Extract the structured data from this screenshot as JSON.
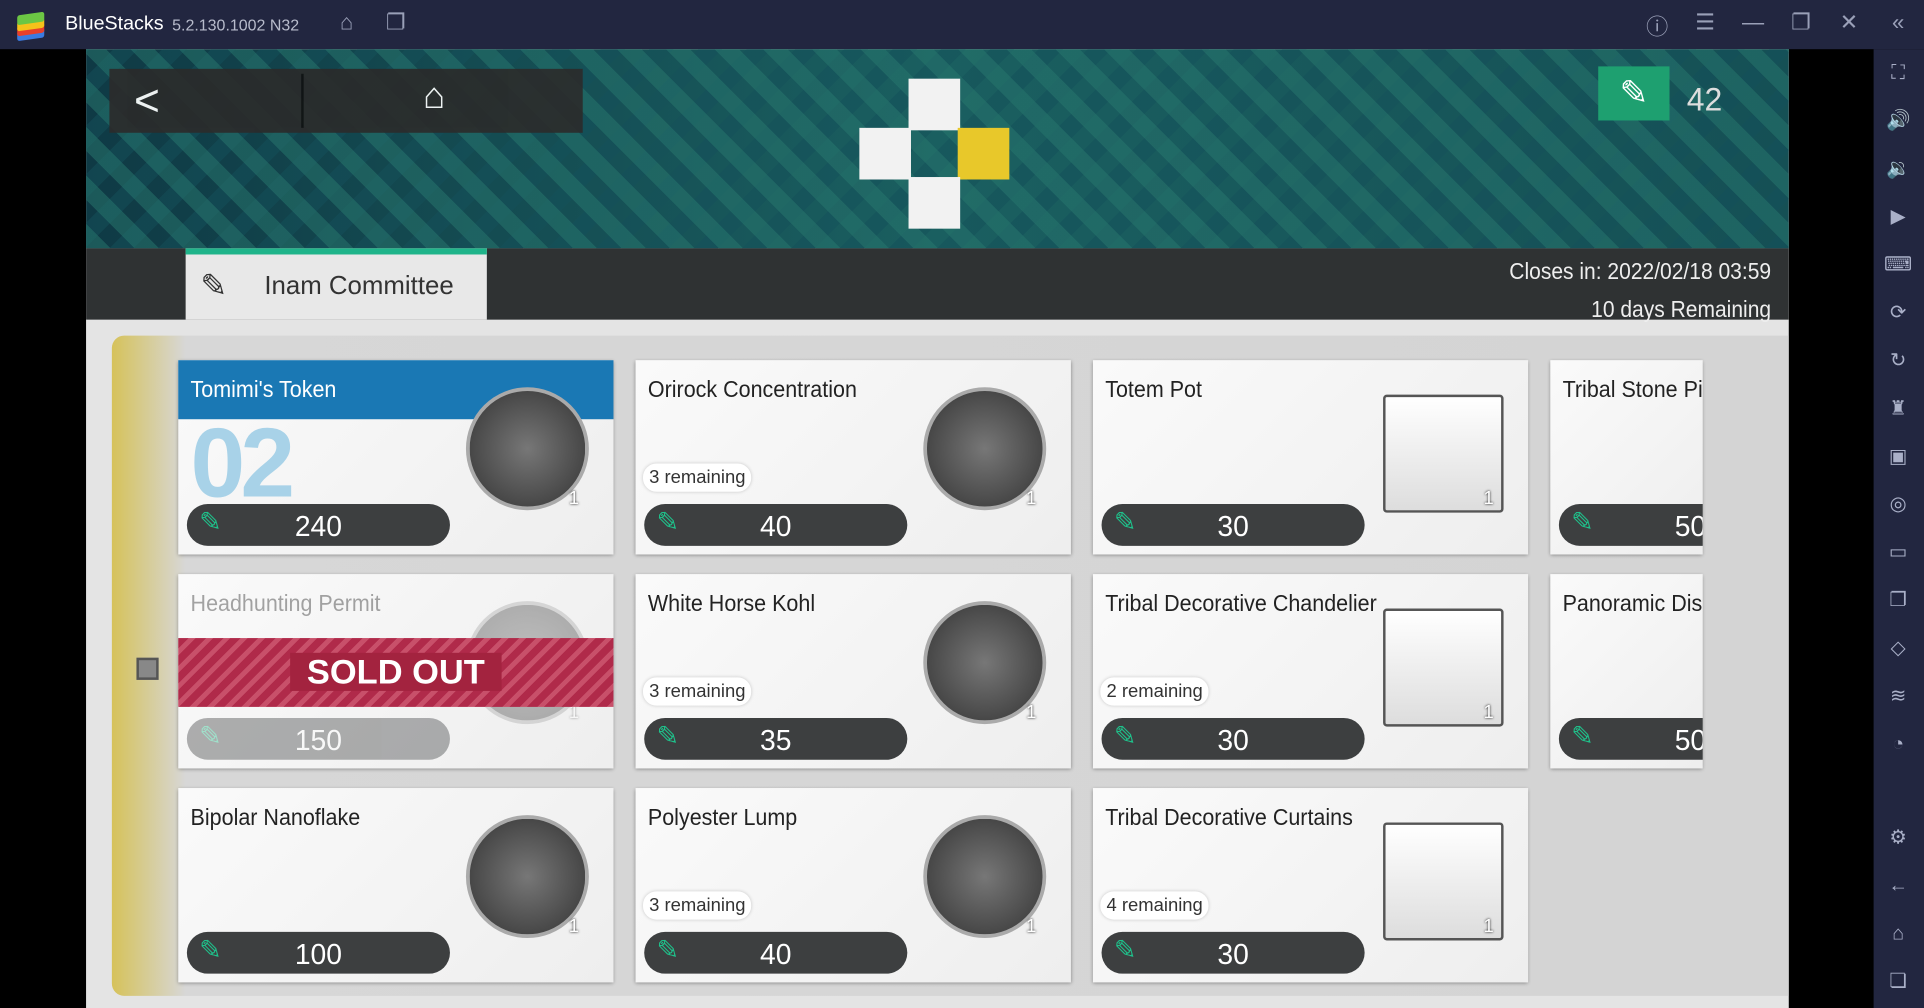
{
  "window": {
    "app_name": "BlueStacks",
    "version": "5.2.130.1002 N32"
  },
  "titlebar_icons": [
    "home-icon",
    "multi-instance-icon",
    "help-icon",
    "menu-icon",
    "minimize-icon",
    "restore-icon",
    "close-icon",
    "collapse-sidebar-icon"
  ],
  "sidebar_icons": [
    "fullscreen-icon",
    "volume-up-icon",
    "volume-down-icon",
    "media-icon",
    "keyboard-icon",
    "macro-icon",
    "rotate-icon",
    "game-controls-icon",
    "apk-icon",
    "screenshot-icon",
    "folder-icon",
    "multi-instance-icon",
    "eraser-icon",
    "layers-icon",
    "performance-icon",
    "settings-icon",
    "back-icon",
    "home-icon",
    "recents-icon"
  ],
  "game": {
    "currency": {
      "value": "42",
      "color": "#1ea070"
    },
    "tab": {
      "label": "Inam Committee"
    },
    "closes": {
      "line1": "Closes in: 2022/02/18 03:59",
      "line2": "10 days Remaining"
    },
    "cards": [
      {
        "title": "Tomimi's Token",
        "price": "240",
        "qty": "1",
        "big": "02",
        "highlight": true
      },
      {
        "title": "Orirock Concentration",
        "remaining": "3 remaining",
        "price": "40",
        "qty": "1"
      },
      {
        "title": "Totem Pot",
        "price": "30",
        "qty": "1",
        "square": true
      },
      {
        "title": "Tribal Stone Pillar",
        "price": "50"
      },
      {
        "title": "Headhunting Permit",
        "price": "150",
        "qty": "1",
        "sold_out": "SOLD OUT"
      },
      {
        "title": "White Horse Kohl",
        "remaining": "3 remaining",
        "price": "35",
        "qty": "1"
      },
      {
        "title": "Tribal Decorative Chandelier",
        "remaining": "2 remaining",
        "price": "30",
        "qty": "1",
        "square": true
      },
      {
        "title": "Panoramic Display (Rai",
        "price": "50"
      },
      {
        "title": "Bipolar Nanoflake",
        "price": "100",
        "qty": "1"
      },
      {
        "title": "Polyester Lump",
        "remaining": "3 remaining",
        "price": "40",
        "qty": "1"
      },
      {
        "title": "Tribal Decorative Curtains",
        "remaining": "4 remaining",
        "price": "30",
        "qty": "1",
        "square": true
      }
    ]
  }
}
